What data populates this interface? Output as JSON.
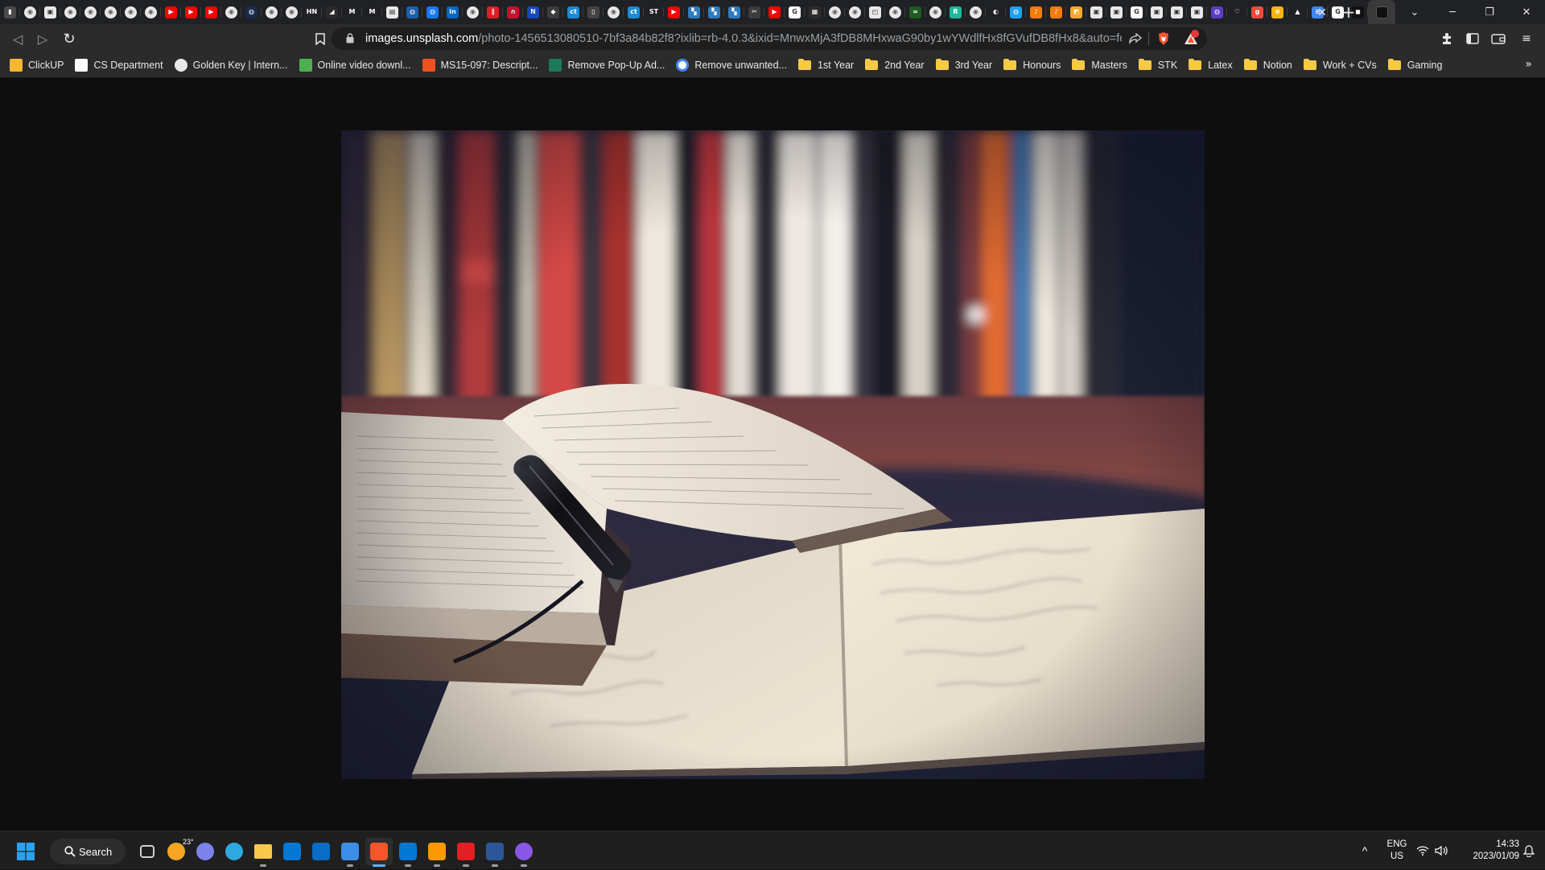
{
  "window": {
    "controls": {
      "minimize": "─",
      "restore": "❐",
      "close": "✕"
    },
    "new_tab_label": "+",
    "tab_search_label": "⌄",
    "tab_close_label": "✕"
  },
  "tabs": [
    {
      "icon": "bookmark-icon",
      "color": "#4b4b4b",
      "glyph": "▮"
    },
    {
      "icon": "globe-icon",
      "color": "#5f6368",
      "glyph": "◉"
    },
    {
      "icon": "page-icon",
      "color": "#e8e8e8",
      "glyph": "▣"
    },
    {
      "icon": "globe-icon",
      "color": "#5f6368",
      "glyph": "◉"
    },
    {
      "icon": "globe-icon",
      "color": "#5f6368",
      "glyph": "◉"
    },
    {
      "icon": "globe-icon",
      "color": "#5f6368",
      "glyph": "◉"
    },
    {
      "icon": "globe-icon",
      "color": "#5f6368",
      "glyph": "◉"
    },
    {
      "icon": "globe-icon",
      "color": "#5f6368",
      "glyph": "◉"
    },
    {
      "icon": "youtube-icon",
      "color": "#ff0000",
      "glyph": "▶"
    },
    {
      "icon": "youtube-icon",
      "color": "#ff0000",
      "glyph": "▶"
    },
    {
      "icon": "youtube-icon",
      "color": "#ff0000",
      "glyph": "▶"
    },
    {
      "icon": "globe-icon",
      "color": "#5f6368",
      "glyph": "◉"
    },
    {
      "icon": "site-icon",
      "color": "#1a2b4c",
      "glyph": "◍"
    },
    {
      "icon": "globe-icon",
      "color": "#5f6368",
      "glyph": "◉"
    },
    {
      "icon": "globe-icon",
      "color": "#5f6368",
      "glyph": "◉"
    },
    {
      "icon": "hacker-news-icon",
      "color": "#202124",
      "glyph": "HN"
    },
    {
      "icon": "site-icon",
      "color": "#2a2a2a",
      "glyph": "◢"
    },
    {
      "icon": "gmail-icon",
      "color": "#202124",
      "glyph": "M"
    },
    {
      "icon": "gmail-icon",
      "color": "#202124",
      "glyph": "M"
    },
    {
      "icon": "page-icon",
      "color": "#e8e8e8",
      "glyph": "▤"
    },
    {
      "icon": "site-icon",
      "color": "#1c5fa8",
      "glyph": "◍"
    },
    {
      "icon": "site-icon",
      "color": "#1877f2",
      "glyph": "◍"
    },
    {
      "icon": "linkedin-icon",
      "color": "#0a66c2",
      "glyph": "in"
    },
    {
      "icon": "globe-icon",
      "color": "#5f6368",
      "glyph": "◉"
    },
    {
      "icon": "site-icon",
      "color": "#e31b23",
      "glyph": "∥"
    },
    {
      "icon": "magnet-icon",
      "color": "#c4122f",
      "glyph": "∩"
    },
    {
      "icon": "site-icon",
      "color": "#1747c4",
      "glyph": "N"
    },
    {
      "icon": "cube-icon",
      "color": "#3c3c3c",
      "glyph": "◆"
    },
    {
      "icon": "site-icon",
      "color": "#1b8ad6",
      "glyph": "ct"
    },
    {
      "icon": "site-icon",
      "color": "#444444",
      "glyph": "▯"
    },
    {
      "icon": "globe-icon",
      "color": "#5f6368",
      "glyph": "◉"
    },
    {
      "icon": "site-icon",
      "color": "#1b8ad6",
      "glyph": "ct"
    },
    {
      "icon": "site-icon",
      "color": "#202124",
      "glyph": "ST"
    },
    {
      "icon": "youtube-icon",
      "color": "#ff0000",
      "glyph": "▶"
    },
    {
      "icon": "site-icon",
      "color": "#2f7bbf",
      "glyph": "▚"
    },
    {
      "icon": "site-icon",
      "color": "#2f7bbf",
      "glyph": "▚"
    },
    {
      "icon": "site-icon",
      "color": "#2f7bbf",
      "glyph": "▚"
    },
    {
      "icon": "tools-icon",
      "color": "#3c3c3c",
      "glyph": "✂"
    },
    {
      "icon": "youtube-icon",
      "color": "#ff0000",
      "glyph": "▶"
    },
    {
      "icon": "google-icon",
      "color": "#ffffff",
      "glyph": "G"
    },
    {
      "icon": "microsoft-icon",
      "color": "#2c2c2c",
      "glyph": "▦"
    },
    {
      "icon": "globe-icon",
      "color": "#5f6368",
      "glyph": "◉"
    },
    {
      "icon": "globe-icon",
      "color": "#5f6368",
      "glyph": "◉"
    },
    {
      "icon": "site-icon",
      "color": "#e8e8e8",
      "glyph": "◰"
    },
    {
      "icon": "globe-icon",
      "color": "#5f6368",
      "glyph": "◉"
    },
    {
      "icon": "site-icon",
      "color": "#1b5e20",
      "glyph": "∞"
    },
    {
      "icon": "globe-icon",
      "color": "#5f6368",
      "glyph": "◉"
    },
    {
      "icon": "site-icon",
      "color": "#1abc9c",
      "glyph": "R"
    },
    {
      "icon": "globe-icon",
      "color": "#5f6368",
      "glyph": "◉"
    },
    {
      "icon": "github-icon",
      "color": "#202124",
      "glyph": "◐"
    },
    {
      "icon": "site-icon",
      "color": "#1da1f2",
      "glyph": "◍"
    },
    {
      "icon": "site-icon",
      "color": "#f57c00",
      "glyph": "♪"
    },
    {
      "icon": "site-icon",
      "color": "#f57c00",
      "glyph": "♪"
    },
    {
      "icon": "site-icon",
      "color": "#f9a825",
      "glyph": "◩"
    },
    {
      "icon": "page-icon",
      "color": "#e8e8e8",
      "glyph": "▣"
    },
    {
      "icon": "page-icon",
      "color": "#e8e8e8",
      "glyph": "▣"
    },
    {
      "icon": "google-icon",
      "color": "#ffffff",
      "glyph": "G"
    },
    {
      "icon": "page-icon",
      "color": "#e8e8e8",
      "glyph": "▣"
    },
    {
      "icon": "page-icon",
      "color": "#e8e8e8",
      "glyph": "▣"
    },
    {
      "icon": "page-icon",
      "color": "#e8e8e8",
      "glyph": "▣"
    },
    {
      "icon": "site-icon",
      "color": "#5b3cc4",
      "glyph": "◍"
    },
    {
      "icon": "heart-icon",
      "color": "#202124",
      "glyph": "♡"
    },
    {
      "icon": "site-icon",
      "color": "#e84b3c",
      "glyph": "g"
    },
    {
      "icon": "site-icon",
      "color": "#f2b705",
      "glyph": "≡"
    },
    {
      "icon": "google-drive-icon",
      "color": "#202124",
      "glyph": "▲"
    },
    {
      "icon": "google-docs-icon",
      "color": "#4285f4",
      "glyph": "≡"
    },
    {
      "icon": "google-icon",
      "color": "#ffffff",
      "glyph": "G"
    },
    {
      "icon": "site-icon",
      "color": "#111111",
      "glyph": "◼"
    }
  ],
  "active_tab": {
    "icon": "image-icon",
    "color": "#3a3a3a",
    "glyph": ""
  },
  "toolbar": {
    "back_label": "◁",
    "forward_label": "▷",
    "reload_label": "↻",
    "url_host": "images.unsplash.com",
    "url_path": "/photo-1456513080510-7bf3a84b82f8?ixlib=rb-4.0.3&ixid=MnwxMjA3fDB8MHxwaG90by1wYWdlfHx8fGVufDB8fHx8&auto=for...",
    "shields_badge_count": "",
    "menu_label": "≡"
  },
  "bookmarks": [
    {
      "label": "ClickUP",
      "kind": "site",
      "icon": "clickup-icon",
      "color": "#f7b731"
    },
    {
      "label": "CS Department",
      "kind": "site",
      "icon": "university-icon",
      "color": "#ffffff"
    },
    {
      "label": "Golden Key | Intern...",
      "kind": "site",
      "icon": "globe-icon",
      "color": "#5f6368"
    },
    {
      "label": "Online video downl...",
      "kind": "site",
      "icon": "download-icon",
      "color": "#4caf50"
    },
    {
      "label": "MS15-097: Descript...",
      "kind": "site",
      "icon": "microsoft-icon",
      "color": "#f25022"
    },
    {
      "label": "Remove Pop-Up Ad...",
      "kind": "site",
      "icon": "leaf-icon",
      "color": "#1b7a5a"
    },
    {
      "label": "Remove unwanted...",
      "kind": "site",
      "icon": "google-icon",
      "color": "#ffffff"
    },
    {
      "label": "1st Year",
      "kind": "folder",
      "icon": "folder-icon"
    },
    {
      "label": "2nd Year",
      "kind": "folder",
      "icon": "folder-icon"
    },
    {
      "label": "3rd Year",
      "kind": "folder",
      "icon": "folder-icon"
    },
    {
      "label": "Honours",
      "kind": "folder",
      "icon": "folder-icon"
    },
    {
      "label": "Masters",
      "kind": "folder",
      "icon": "folder-icon"
    },
    {
      "label": "STK",
      "kind": "folder",
      "icon": "folder-icon"
    },
    {
      "label": "Latex",
      "kind": "folder",
      "icon": "folder-icon"
    },
    {
      "label": "Notion",
      "kind": "folder",
      "icon": "folder-icon"
    },
    {
      "label": "Work + CVs",
      "kind": "folder",
      "icon": "folder-icon"
    },
    {
      "label": "Gaming",
      "kind": "folder",
      "icon": "folder-icon"
    }
  ],
  "bookmarks_overflow_label": "»",
  "photo": {
    "subject": "open books with a pen on a desk in front of a bookshelf",
    "colors": {
      "shelf_bg": "#2a2a3c",
      "desk": "#8a4a3e",
      "page": "#efe6d6",
      "shadow": "#232640"
    }
  },
  "taskbar": {
    "search_label": "Search",
    "weather_temp": "23°",
    "apps": [
      {
        "name": "task-view-icon",
        "color": "#d0d0d0",
        "running": false
      },
      {
        "name": "weather-icon",
        "color": "#f5a623",
        "running": false
      },
      {
        "name": "teams-chat-icon",
        "color": "#7b83eb",
        "running": false
      },
      {
        "name": "edge-icon",
        "color": "#2fa8e0",
        "running": false
      },
      {
        "name": "file-explorer-icon",
        "color": "#f7c948",
        "running": true
      },
      {
        "name": "microsoft-store-icon",
        "color": "#0078d4",
        "running": false
      },
      {
        "name": "mail-icon",
        "color": "#0a6cc4",
        "running": false
      },
      {
        "name": "todo-icon",
        "color": "#3b8eea",
        "running": true
      },
      {
        "name": "brave-icon",
        "color": "#fb542b",
        "running": true,
        "active": true
      },
      {
        "name": "skype-icon",
        "color": "#0078d4",
        "running": true
      },
      {
        "name": "sublime-icon",
        "color": "#ff9800",
        "running": true
      },
      {
        "name": "acrobat-icon",
        "color": "#e31e24",
        "running": true
      },
      {
        "name": "word-icon",
        "color": "#2b579a",
        "running": true
      },
      {
        "name": "github-desktop-icon",
        "color": "#8957e5",
        "running": true
      }
    ],
    "tray": {
      "chevron_label": "^",
      "lang_top": "ENG",
      "lang_bottom": "US",
      "time": "14:33",
      "date": "2023/01/09"
    }
  }
}
